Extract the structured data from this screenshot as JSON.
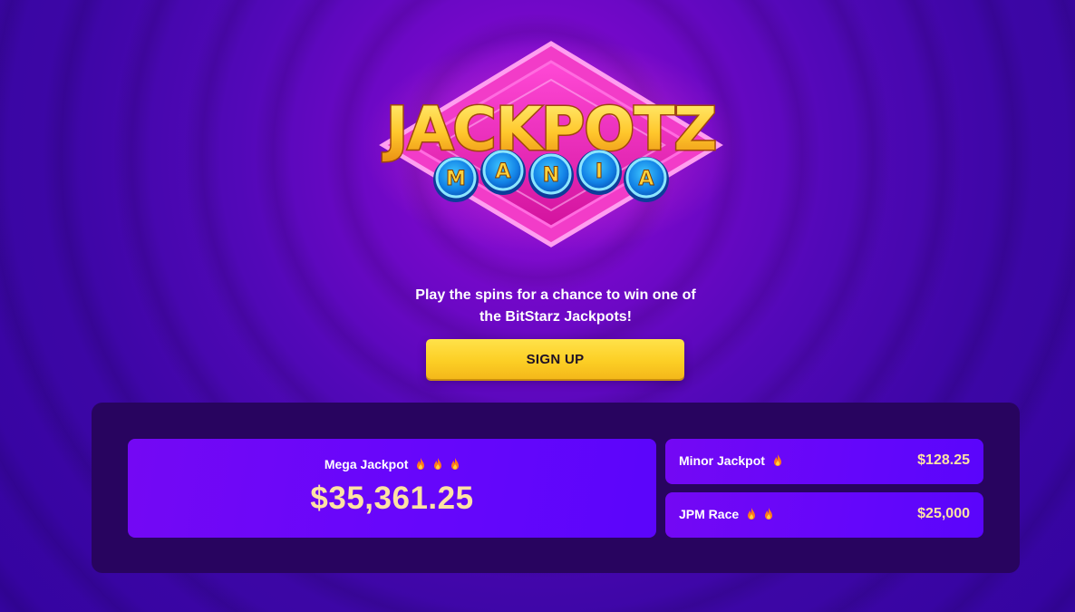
{
  "logo": {
    "line1": "JACKPOTZ",
    "line2_letters": [
      "M",
      "A",
      "N",
      "I",
      "A"
    ]
  },
  "promo": {
    "line1": "Play the spins for a chance to win one of",
    "line2": "the BitStarz Jackpots!",
    "cta_label": "SIGN UP"
  },
  "jackpots": {
    "mega": {
      "label": "Mega Jackpot",
      "value": "$35,361.25",
      "fire_count": 3
    },
    "minor": {
      "label": "Minor Jackpot",
      "value": "$128.25",
      "fire_count": 1
    },
    "race": {
      "label": "JPM Race",
      "value": "$25,000",
      "fire_count": 2
    }
  },
  "colors": {
    "background": "#4a06b0",
    "panel": "#28045f",
    "card": "#6806fb",
    "value_text": "#fde2a4",
    "cta": "#fccf25",
    "fire": "#ff7a1a"
  },
  "icons": {
    "fire": "fire-icon"
  }
}
